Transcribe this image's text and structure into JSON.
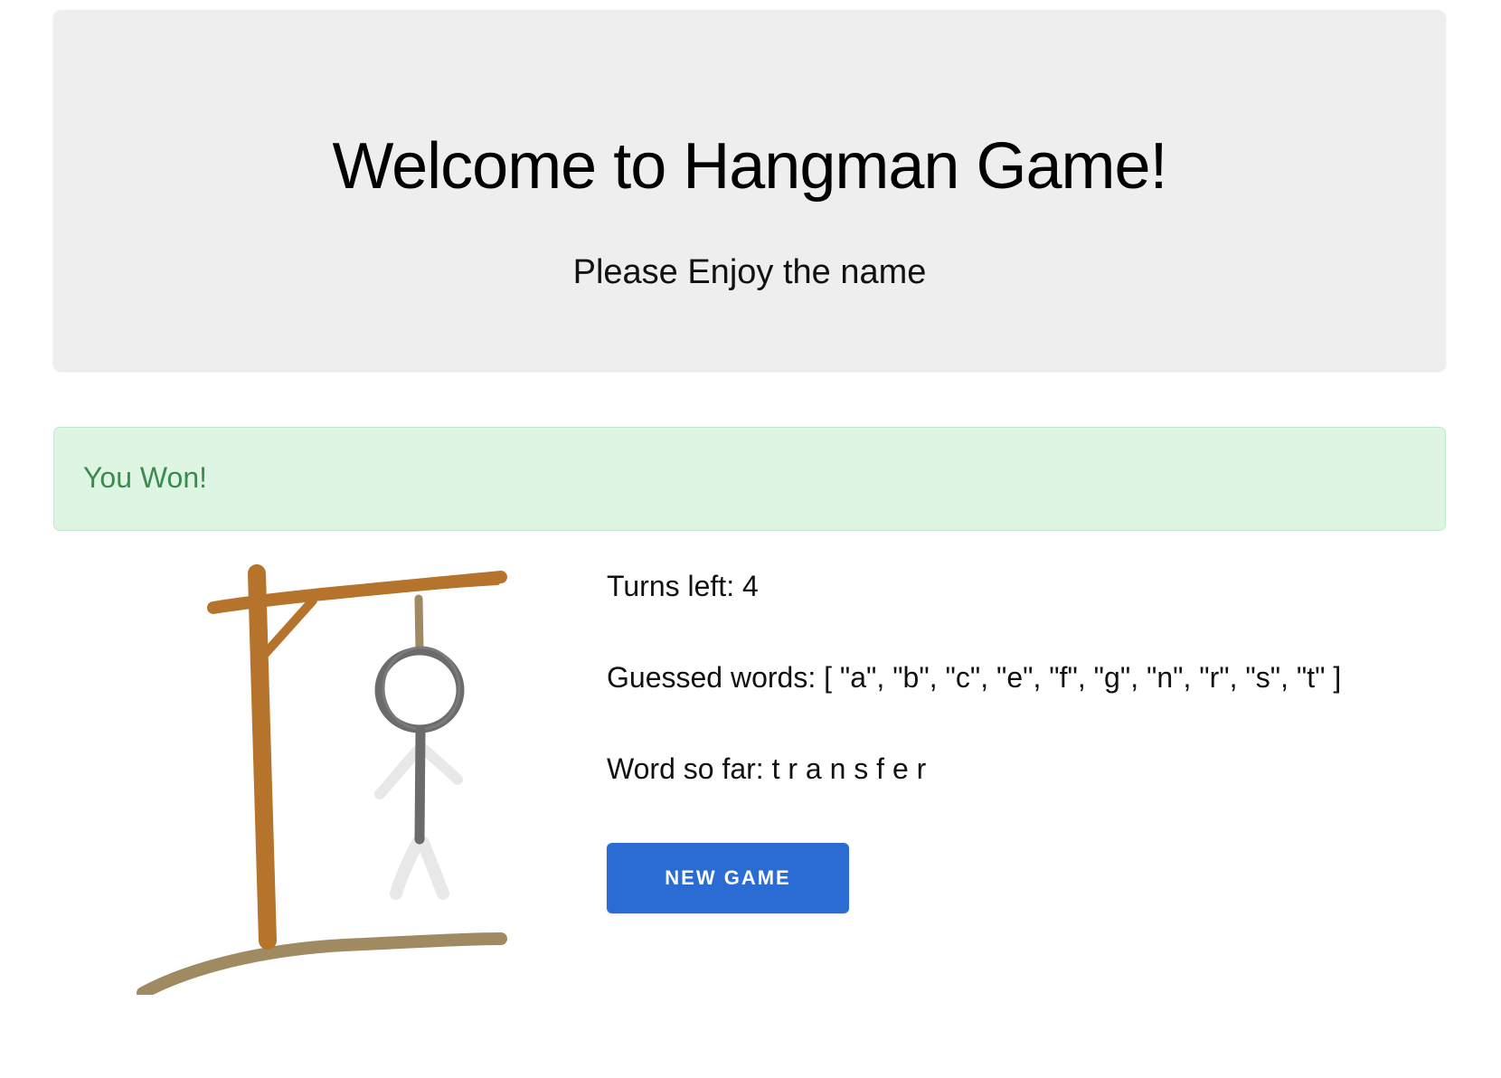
{
  "header": {
    "title": "Welcome to Hangman Game!",
    "subtitle": "Please Enjoy the name"
  },
  "alert": {
    "message": "You Won!",
    "color": "#3c8a4e",
    "background": "#dff5e4"
  },
  "game": {
    "turns_left": "Turns left: 4",
    "guessed_words": "Guessed words: [ \"a\", \"b\", \"c\", \"e\", \"f\", \"g\", \"n\", \"r\", \"s\", \"t\" ]",
    "word_so_far": "Word so far: t r a n s f e r",
    "new_game_label": "NEW GAME",
    "button_color": "#2b6cd4"
  },
  "illustration": {
    "name": "gallows-with-stick-figure",
    "wood_color": "#b5732b",
    "ground_color": "#a08a62",
    "figure_color": "#6b6b6b"
  }
}
